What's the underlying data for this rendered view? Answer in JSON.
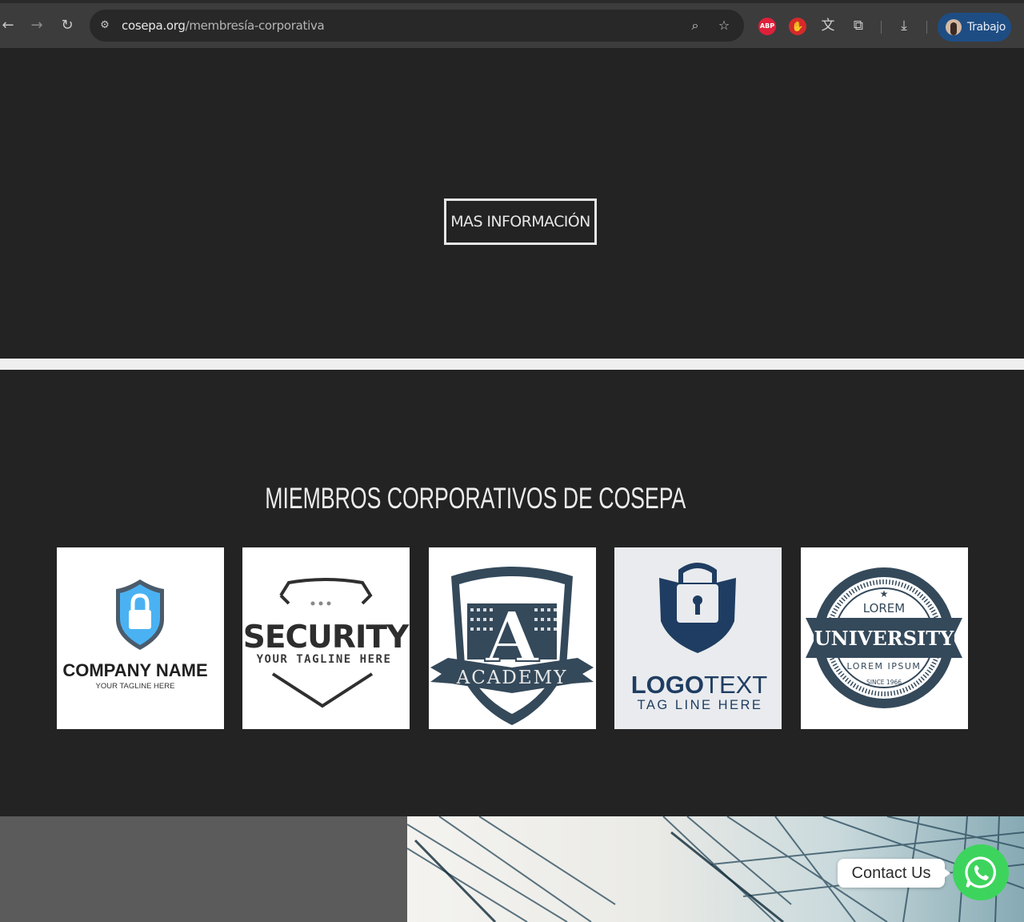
{
  "browser": {
    "url_domain": "cosepa.org",
    "url_path": "/membresía-corporativa",
    "profile_label": "Trabajo",
    "extensions": [
      {
        "name": "adblock-plus-icon",
        "label": "ABP",
        "color": "#e0203a"
      },
      {
        "name": "stop-hand-icon",
        "label": "",
        "color": "#d42a2a"
      }
    ]
  },
  "hero": {
    "button_label": "MAS INFORMACIÓN"
  },
  "members": {
    "title": "MIEMBROS CORPORATIVOS DE COSEPA",
    "logos": [
      {
        "name": "company-name-logo",
        "text": "COMPANY NAME",
        "tagline": "YOUR TAGLINE HERE"
      },
      {
        "name": "security-logo",
        "text": "SECURITY",
        "tagline": "YOUR TAGLINE HERE"
      },
      {
        "name": "academy-logo",
        "text": "ACADEMY",
        "letter": "A"
      },
      {
        "name": "logotext-logo",
        "text_bold": "LOGO",
        "text_light": "TEXT",
        "tagline": "TAG LINE HERE"
      },
      {
        "name": "university-logo",
        "top": "LOREM",
        "text": "UNIVERSITY",
        "sub": "LOREM IPSUM",
        "since": "SINCE 1966"
      }
    ]
  },
  "contact": {
    "label": "Contact Us"
  }
}
